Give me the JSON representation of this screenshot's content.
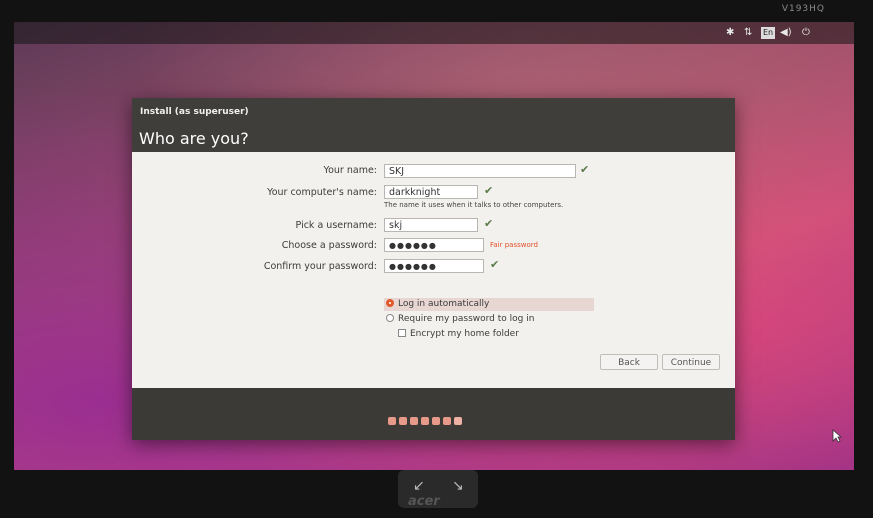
{
  "bezel": {
    "model": "V193HQ",
    "logo": "acer"
  },
  "tray": {
    "accessibility_icon": "accessibility-icon",
    "keyboard": "En",
    "volume_icon": "volume-icon",
    "power_icon": "power-icon"
  },
  "window": {
    "title": "Install (as superuser)",
    "heading": "Who are you?",
    "fields": {
      "name_label": "Your name:",
      "name_value": "SKJ",
      "computer_label": "Your computer's name:",
      "computer_value": "darkknight",
      "computer_hint": "The name it uses when it talks to other computers.",
      "username_label": "Pick a username:",
      "username_value": "skj",
      "password_label": "Choose a password:",
      "password_value": "●●●●●●",
      "password_strength": "Fair password",
      "confirm_label": "Confirm your password:",
      "confirm_value": "●●●●●●"
    },
    "options": {
      "auto_login": "Log in automatically",
      "require_password": "Require my password to log in",
      "encrypt_home": "Encrypt my home folder"
    },
    "buttons": {
      "back": "Back",
      "continue": "Continue"
    },
    "progress": {
      "total": 7,
      "current": 7
    }
  },
  "colors": {
    "accent": "#e05a30",
    "check": "#5a7a4a",
    "titlebar": "#3f3e3a"
  }
}
